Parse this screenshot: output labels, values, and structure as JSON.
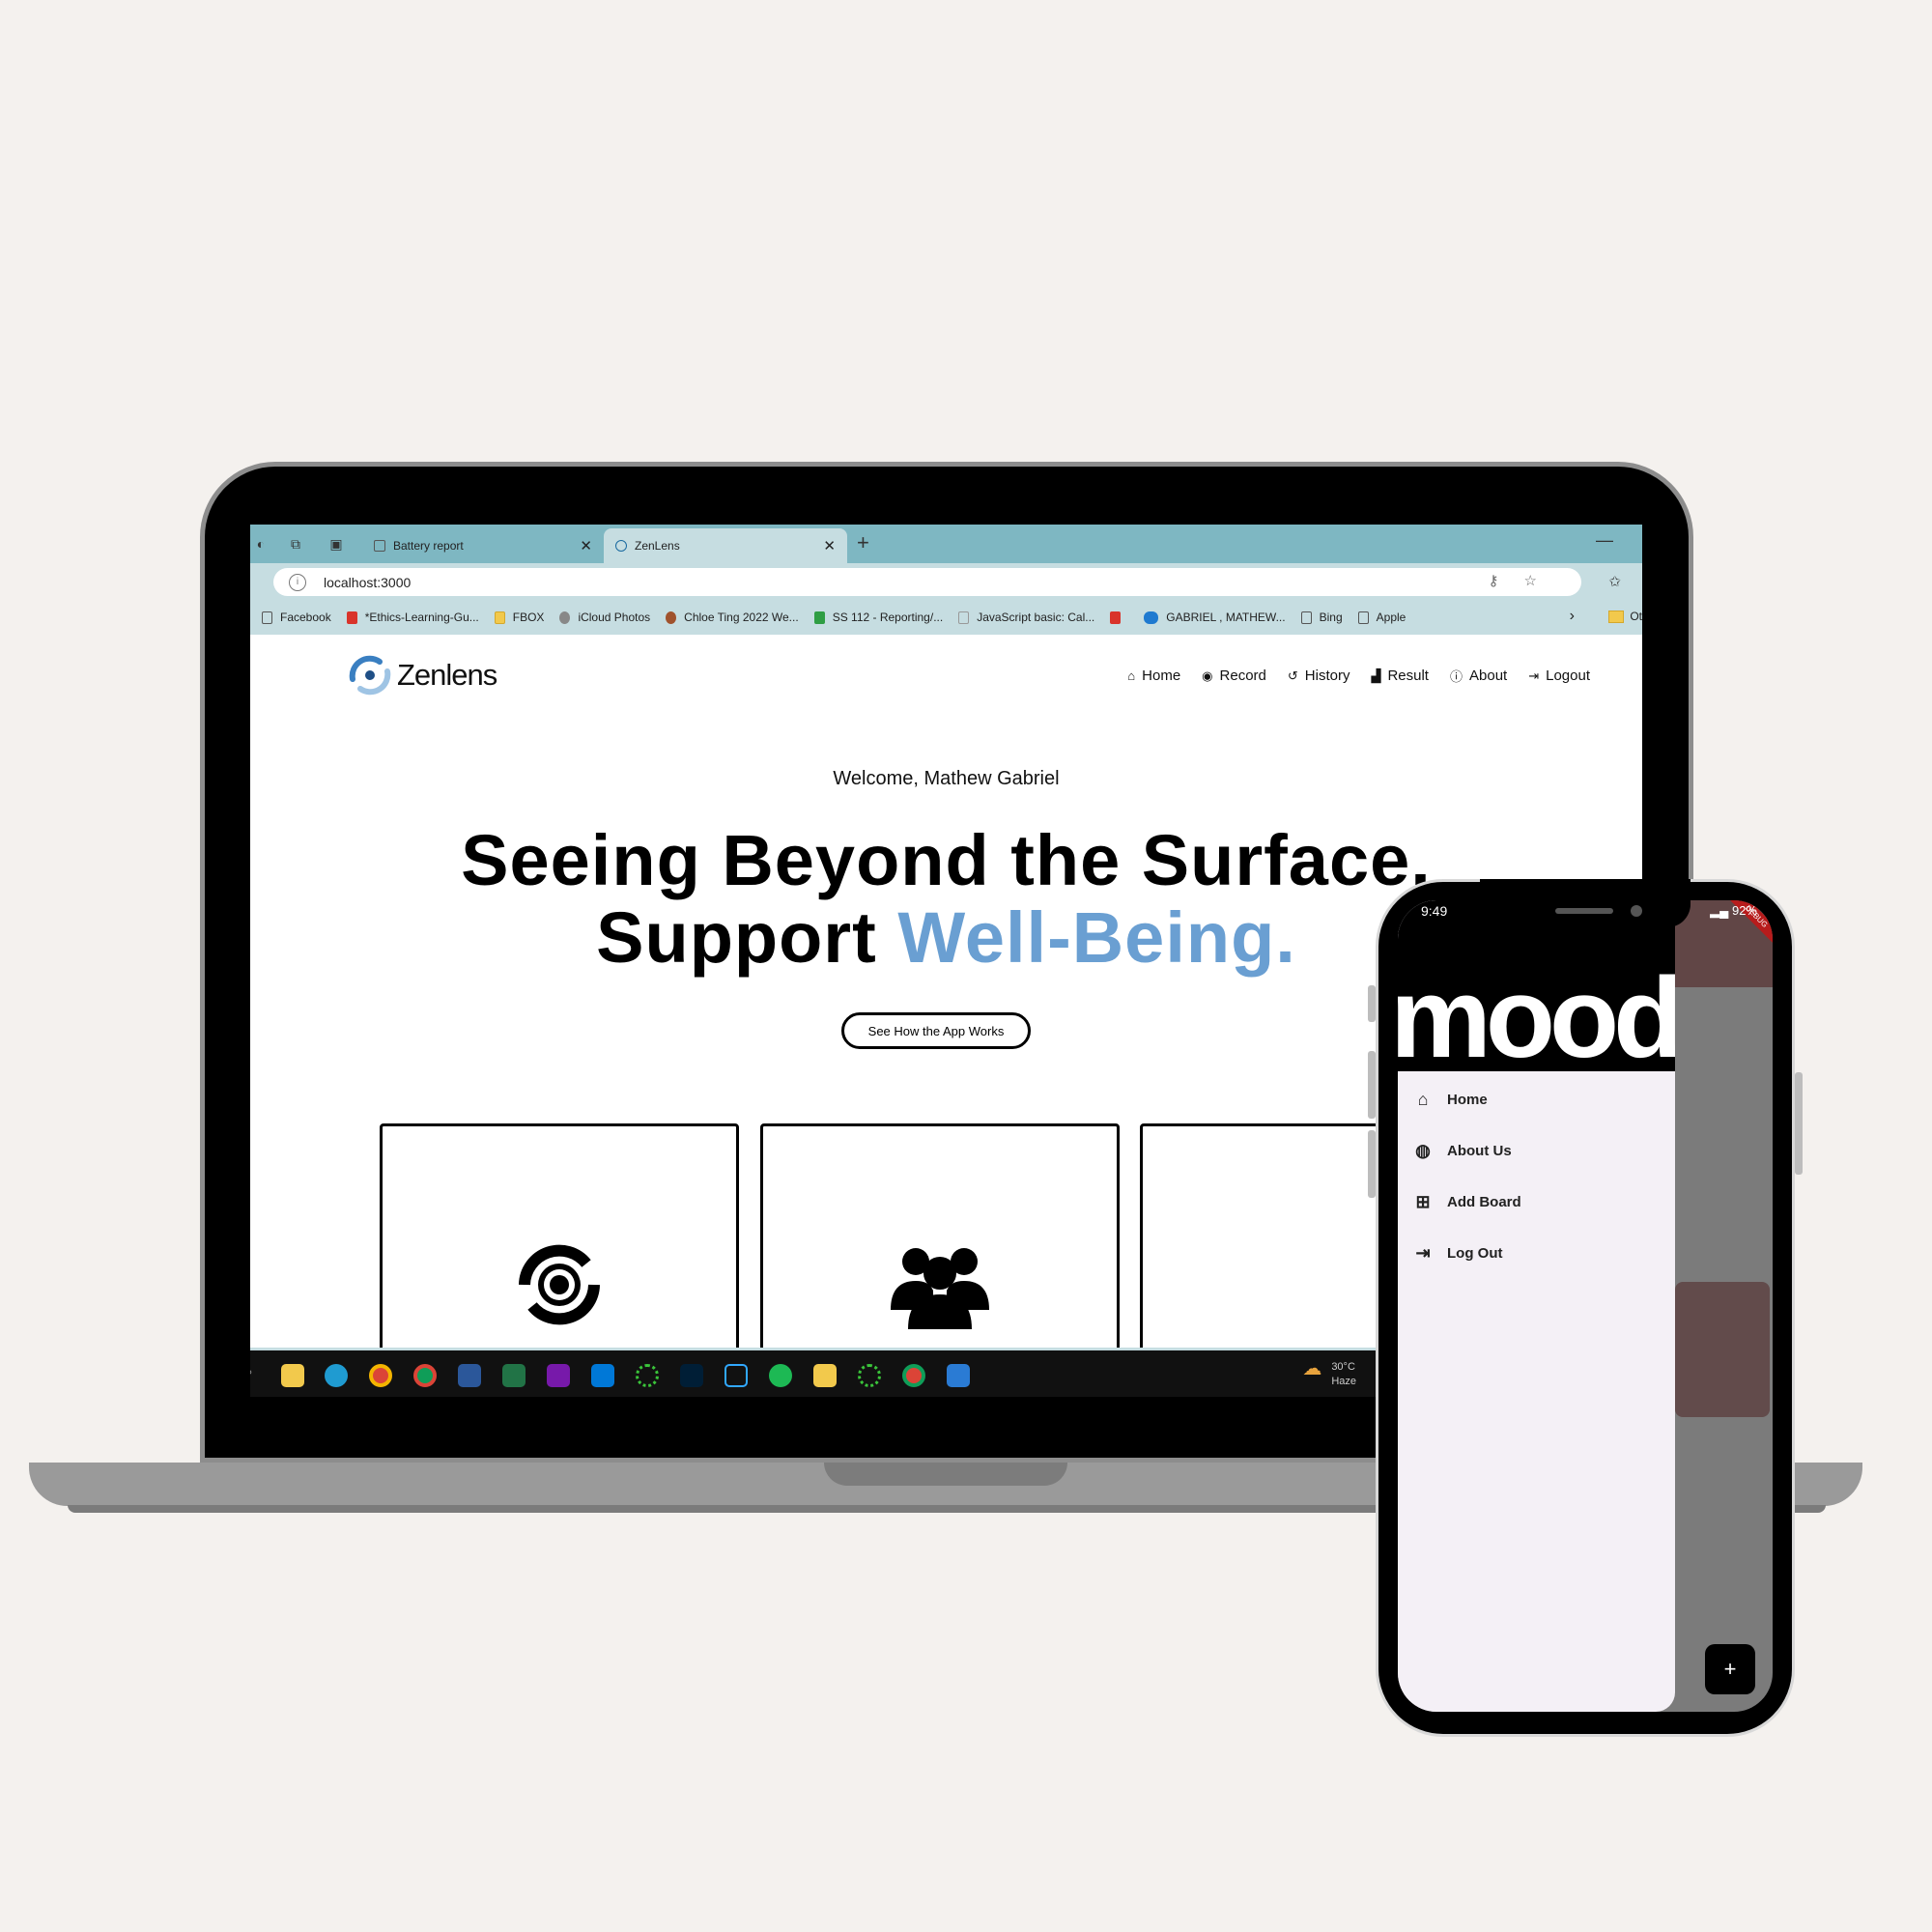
{
  "browser": {
    "tabs": [
      {
        "label": "Battery report"
      },
      {
        "label": "ZenLens"
      }
    ],
    "address": "localhost:3000",
    "bookmarks": [
      {
        "label": "Facebook"
      },
      {
        "label": "*Ethics-Learning-Gu..."
      },
      {
        "label": "FBOX"
      },
      {
        "label": "iCloud Photos"
      },
      {
        "label": "Chloe Ting 2022 We..."
      },
      {
        "label": "SS 112 - Reporting/..."
      },
      {
        "label": "JavaScript basic: Cal..."
      },
      {
        "label": ""
      },
      {
        "label": "GABRIEL , MATHEW..."
      },
      {
        "label": "Bing"
      },
      {
        "label": "Apple"
      }
    ],
    "other_bookmarks": "Ot"
  },
  "site": {
    "logo": "Zenlens",
    "nav": [
      {
        "label": "Home",
        "icon": "home-icon"
      },
      {
        "label": "Record",
        "icon": "record-icon"
      },
      {
        "label": "History",
        "icon": "history-icon"
      },
      {
        "label": "Result",
        "icon": "result-icon"
      },
      {
        "label": "About",
        "icon": "help-icon"
      },
      {
        "label": "Logout",
        "icon": "logout-icon"
      }
    ],
    "welcome": "Welcome, Mathew Gabriel",
    "hero_line1": "Seeing Beyond the Surface.",
    "hero_line2_prefix": "Support ",
    "hero_line2_accent": "Well-Being.",
    "cta": "See How the App Works",
    "accent_color": "#6a9fd2",
    "cards": [
      {
        "icon": "eye-icon"
      },
      {
        "icon": "users-icon"
      },
      {
        "icon": "document-icon"
      }
    ]
  },
  "taskbar": {
    "weather_temp": "30°C",
    "weather_desc": "Haze"
  },
  "phone": {
    "time": "9:49",
    "battery": "92%",
    "banner": "mood",
    "debug": "DEBUG",
    "drawer_items": [
      {
        "label": "Home",
        "icon": "home-icon"
      },
      {
        "label": "About Us",
        "icon": "globe-icon"
      },
      {
        "label": "Add Board",
        "icon": "add-box-icon"
      },
      {
        "label": "Log Out",
        "icon": "logout-icon"
      }
    ],
    "fab": "+"
  }
}
